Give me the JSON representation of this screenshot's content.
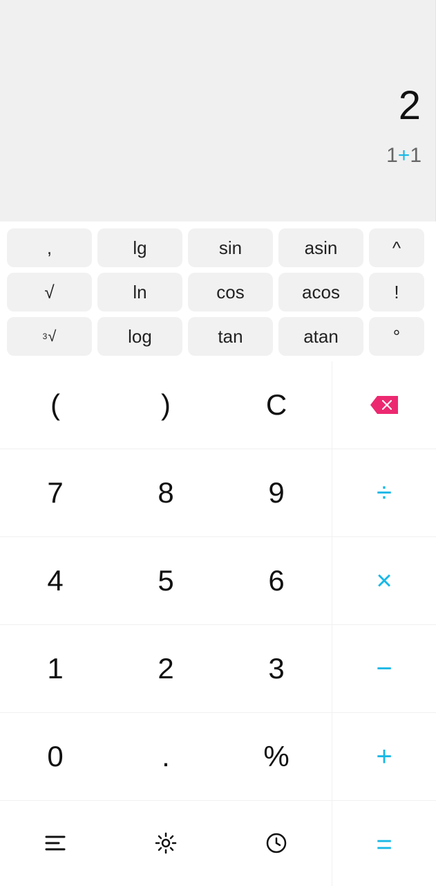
{
  "display": {
    "result": "2",
    "expression": {
      "left": "1",
      "op": "+",
      "right": "1"
    }
  },
  "sci": {
    "row1": {
      "comma": ",",
      "lg": "lg",
      "sin": "sin",
      "asin": "asin",
      "caret": "^"
    },
    "row2": {
      "sqrt": "√",
      "ln": "ln",
      "cos": "cos",
      "acos": "acos",
      "fact": "!"
    },
    "row3": {
      "cbrt_sup": "3",
      "cbrt_root": "√",
      "log": "log",
      "tan": "tan",
      "atan": "atan",
      "deg": "°"
    }
  },
  "keys": {
    "lparen": "(",
    "rparen": ")",
    "clear": "C",
    "backspace": "⌫",
    "n7": "7",
    "n8": "8",
    "n9": "9",
    "n4": "4",
    "n5": "5",
    "n6": "6",
    "n1": "1",
    "n2": "2",
    "n3": "3",
    "n0": "0",
    "dot": ".",
    "pct": "%",
    "divide": "÷",
    "multiply": "×",
    "minus": "−",
    "plus": "+",
    "equals": "="
  },
  "bottom": {
    "menu": "menu",
    "settings": "settings",
    "history": "history"
  },
  "colors": {
    "accent": "#18b8e6",
    "backspace": "#ec2970",
    "sci_bg": "#f1f1f1",
    "display_bg": "#f0f0f0"
  }
}
